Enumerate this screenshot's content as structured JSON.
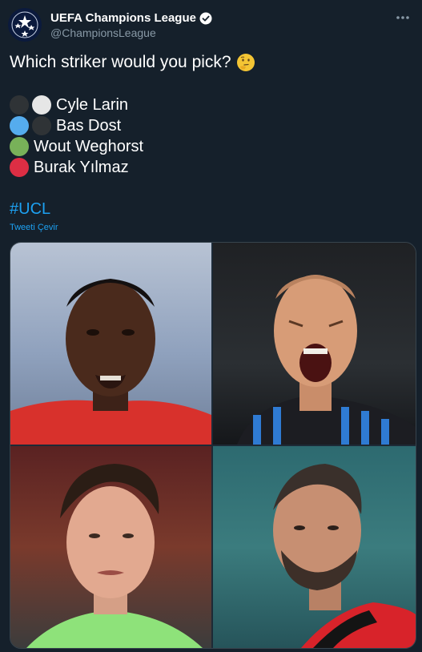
{
  "account": {
    "display_name": "UEFA Champions League",
    "handle": "@ChampionsLeague",
    "verified_icon": "verified-badge-icon",
    "avatar_icon": "ucl-starball-logo"
  },
  "tweet": {
    "question": "Which striker would you pick?",
    "emoji": "thinking-face-emoji",
    "options": [
      {
        "label": "Cyle Larin",
        "colors": [
          "#2f3336",
          "#e6e6e6"
        ]
      },
      {
        "label": "Bas Dost",
        "colors": [
          "#55acee",
          "#2f3336"
        ]
      },
      {
        "label": "Wout Weghorst",
        "colors": [
          "#78b159"
        ]
      },
      {
        "label": "Burak Yılmaz",
        "colors": [
          "#dd2e44"
        ]
      }
    ],
    "hashtag": "#UCL",
    "translate_label": "Tweeti Çevir"
  },
  "media": {
    "photos": [
      {
        "subject": "player-photo-red-kit"
      },
      {
        "subject": "player-photo-striped-kit"
      },
      {
        "subject": "player-photo-green-kit"
      },
      {
        "subject": "player-photo-red-black-kit"
      }
    ]
  }
}
